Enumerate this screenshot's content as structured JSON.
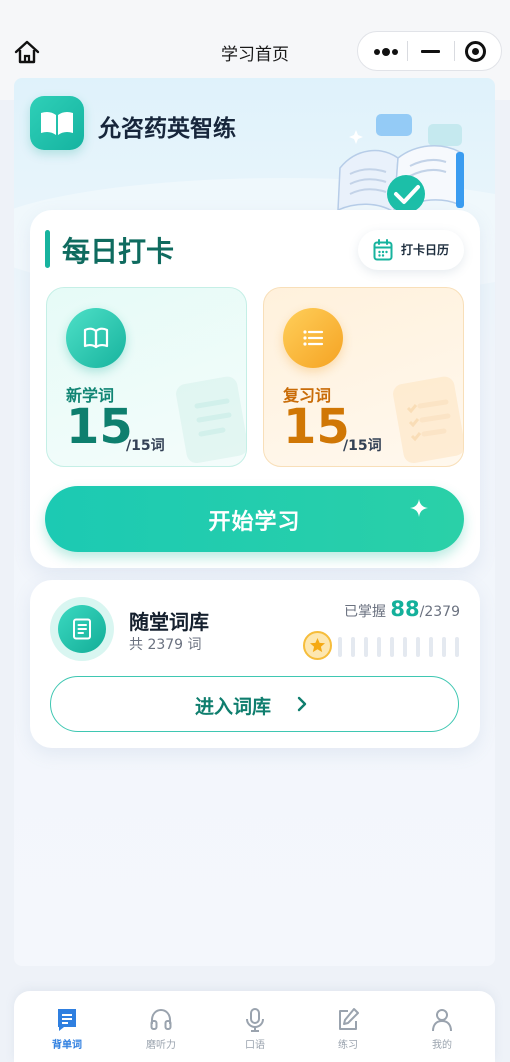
{
  "navbar": {
    "title": "学习首页",
    "home_icon": "home-icon",
    "more_icon": "more-dots-icon",
    "minimize_icon": "minimize-icon",
    "close_icon": "target-close-icon"
  },
  "app": {
    "name": "允咨药英智练",
    "logo_icon": "open-book-icon"
  },
  "daily": {
    "title": "每日打卡",
    "calendar_label": "打卡日历",
    "new_words": {
      "label": "新学词",
      "count": "15",
      "total": "/15词",
      "icon": "book-icon"
    },
    "review_words": {
      "label": "复习词",
      "count": "15",
      "total": "/15词",
      "icon": "list-icon"
    },
    "start_label": "开始学习"
  },
  "library": {
    "title": "随堂词库",
    "count_text": "共 2379 词",
    "mastered_prefix": "已掌握",
    "mastered_count": "88",
    "mastered_total": "/2379",
    "mastered_fraction": 0.037,
    "enter_label": "进入词库"
  },
  "tabs": [
    {
      "label": "背单词",
      "icon": "word-card-icon",
      "active": true
    },
    {
      "label": "磨听力",
      "icon": "headphones-icon",
      "active": false
    },
    {
      "label": "口语",
      "icon": "microphone-icon",
      "active": false
    },
    {
      "label": "练习",
      "icon": "edit-icon",
      "active": false
    },
    {
      "label": "我的",
      "icon": "user-icon",
      "active": false
    }
  ],
  "colors": {
    "accent": "#17b39e",
    "review_accent": "#d07705",
    "tab_active": "#2f7fe0"
  }
}
